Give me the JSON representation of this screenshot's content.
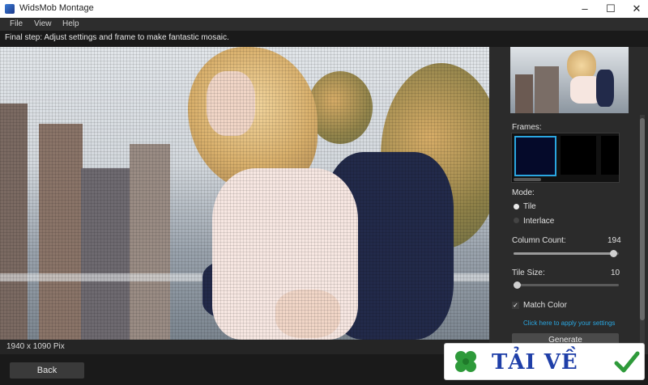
{
  "window": {
    "title": "WidsMob Montage",
    "minimize": "–",
    "maximize": "☐",
    "close": "✕"
  },
  "menu": [
    "File",
    "View",
    "Help"
  ],
  "step_text": "Final step: Adjust settings and frame to make fantastic mosaic.",
  "status": {
    "dimensions": "1940 x 1090 Pix"
  },
  "sidebar": {
    "frames_label": "Frames:",
    "mode_label": "Mode:",
    "modes": [
      {
        "label": "Tile",
        "selected": true
      },
      {
        "label": "Interlace",
        "selected": false
      }
    ],
    "column_count": {
      "label": "Column Count:",
      "value": "194",
      "fraction": 0.98
    },
    "tile_size": {
      "label": "Tile Size:",
      "value": "10",
      "fraction": 0.0
    },
    "match_color": {
      "label": "Match Color",
      "checked": true,
      "mark": "✓"
    },
    "apply_link": "Click here to apply your settings",
    "generate_label": "Generate"
  },
  "back_label": "Back",
  "watermark": {
    "text": "TẢI VỀ"
  },
  "colors": {
    "accent": "#2aa6e0",
    "background": "#1e1e1e",
    "watermark_text": "#1f3fa8"
  }
}
